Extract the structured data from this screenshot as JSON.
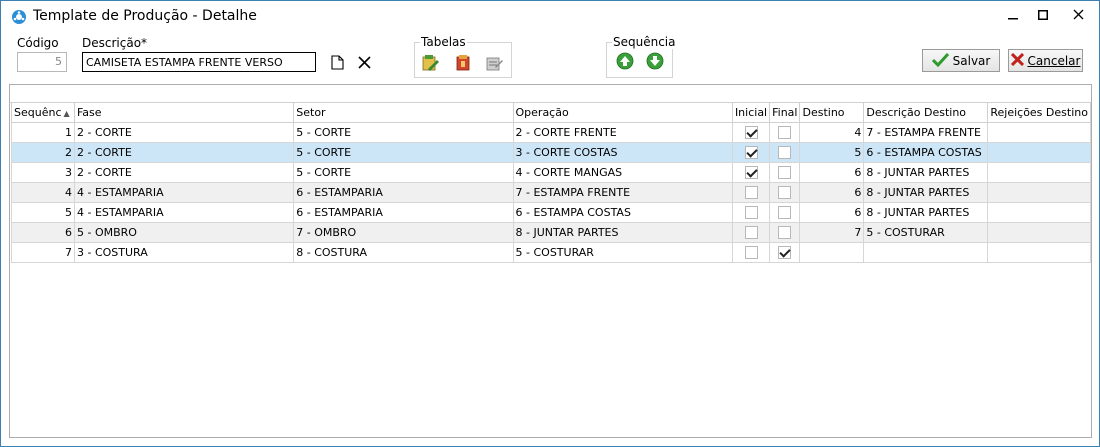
{
  "window": {
    "title": "Template de Produção - Detalhe",
    "icons": {
      "app": "app-gear-icon",
      "minimize": "minimize-icon",
      "maximize": "maximize-icon",
      "close": "close-icon"
    }
  },
  "form": {
    "codigo_label": "Código",
    "codigo_value": "5",
    "descricao_label": "Descrição*",
    "descricao_value": "CAMISETA ESTAMPA FRENTE VERSO",
    "new_icon": "new-document-icon",
    "clear_icon": "clear-x-icon"
  },
  "tabelas": {
    "title": "Tabelas",
    "icons": [
      "table-pencil-icon",
      "table-red-box-icon",
      "table-gray-edit-icon"
    ]
  },
  "sequencia": {
    "title": "Sequência",
    "icons": [
      "arrow-up-green-icon",
      "arrow-down-green-icon"
    ]
  },
  "buttons": {
    "save_label": "Salvar",
    "cancel_label": "Cancelar",
    "save_icon": "check-green-icon",
    "cancel_icon": "x-red-icon"
  },
  "colors": {
    "selected_row": "#cde6f7",
    "alt_row": "#f0f0f0",
    "green": "#3aa13a",
    "red": "#c0211b",
    "window_border": "#3c7fb1"
  },
  "grid": {
    "headers": [
      "Sequênc",
      "Fase",
      "Setor",
      "Operação",
      "Inicial",
      "Final",
      "Destino",
      "Descrição Destino",
      "Rejeições Destino"
    ],
    "sort_column": "Sequênc",
    "rows": [
      {
        "seq": "1",
        "fase": "2 - CORTE",
        "setor": "5 - CORTE",
        "operacao": "2 - CORTE FRENTE",
        "inicial": true,
        "final": false,
        "destino": "4",
        "desc_destino": "7 - ESTAMPA FRENTE",
        "rejeicoes": ""
      },
      {
        "seq": "2",
        "fase": "2 - CORTE",
        "setor": "5 - CORTE",
        "operacao": "3 - CORTE COSTAS",
        "inicial": true,
        "final": false,
        "destino": "5",
        "desc_destino": "6 - ESTAMPA COSTAS",
        "rejeicoes": ""
      },
      {
        "seq": "3",
        "fase": "2 - CORTE",
        "setor": "5 - CORTE",
        "operacao": "4 - CORTE MANGAS",
        "inicial": true,
        "final": false,
        "destino": "6",
        "desc_destino": "8 - JUNTAR PARTES",
        "rejeicoes": ""
      },
      {
        "seq": "4",
        "fase": "4 - ESTAMPARIA",
        "setor": "6 - ESTAMPARIA",
        "operacao": "7 - ESTAMPA FRENTE",
        "inicial": false,
        "final": false,
        "destino": "6",
        "desc_destino": "8 - JUNTAR PARTES",
        "rejeicoes": ""
      },
      {
        "seq": "5",
        "fase": "4 - ESTAMPARIA",
        "setor": "6 - ESTAMPARIA",
        "operacao": "6 - ESTAMPA COSTAS",
        "inicial": false,
        "final": false,
        "destino": "6",
        "desc_destino": "8 - JUNTAR PARTES",
        "rejeicoes": ""
      },
      {
        "seq": "6",
        "fase": "5 - OMBRO",
        "setor": "7 - OMBRO",
        "operacao": "8 - JUNTAR PARTES",
        "inicial": false,
        "final": false,
        "destino": "7",
        "desc_destino": "5 - COSTURAR",
        "rejeicoes": ""
      },
      {
        "seq": "7",
        "fase": "3 - COSTURA",
        "setor": "8 - COSTURA",
        "operacao": "5 - COSTURAR",
        "inicial": false,
        "final": true,
        "destino": "",
        "desc_destino": "",
        "rejeicoes": ""
      }
    ],
    "selected_row_index": 1
  }
}
